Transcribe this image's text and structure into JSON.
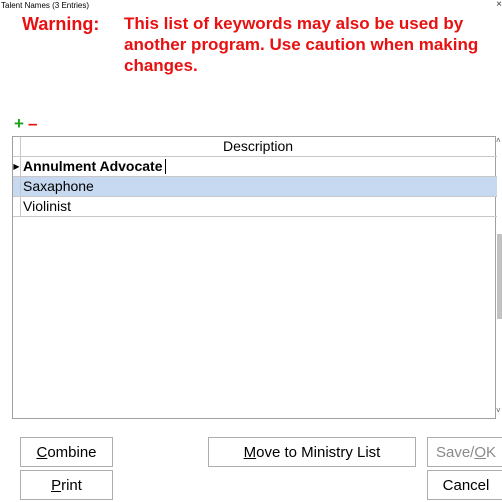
{
  "window": {
    "title": "Talent Names (3 Entries)",
    "close_glyph": "×"
  },
  "warning": {
    "label": "Warning:",
    "text": "This list of keywords may also be used by another program. Use caution when making changes.",
    "color": "#e81010"
  },
  "toolbar": {
    "add_glyph": "+",
    "remove_glyph": "–",
    "add_color": "#1aa31a",
    "remove_color": "#e81010"
  },
  "grid": {
    "columns": [
      "Description"
    ],
    "rows": [
      "Annulment Advocate",
      "Saxaphone",
      "Violinist"
    ],
    "current_row_indicator": "▶",
    "selected_row_color": "#c7d9f0"
  },
  "scroll": {
    "up_glyph": "˄",
    "down_glyph": "˅"
  },
  "buttons": {
    "combine": {
      "accel": "C",
      "rest": "ombine"
    },
    "print": {
      "accel": "P",
      "rest": "rint"
    },
    "move": {
      "accel": "M",
      "rest": "ove to Ministry List"
    },
    "save": {
      "prefix": "Save/",
      "accel": "O",
      "rest": "K"
    },
    "cancel": {
      "label": "Cancel"
    }
  }
}
